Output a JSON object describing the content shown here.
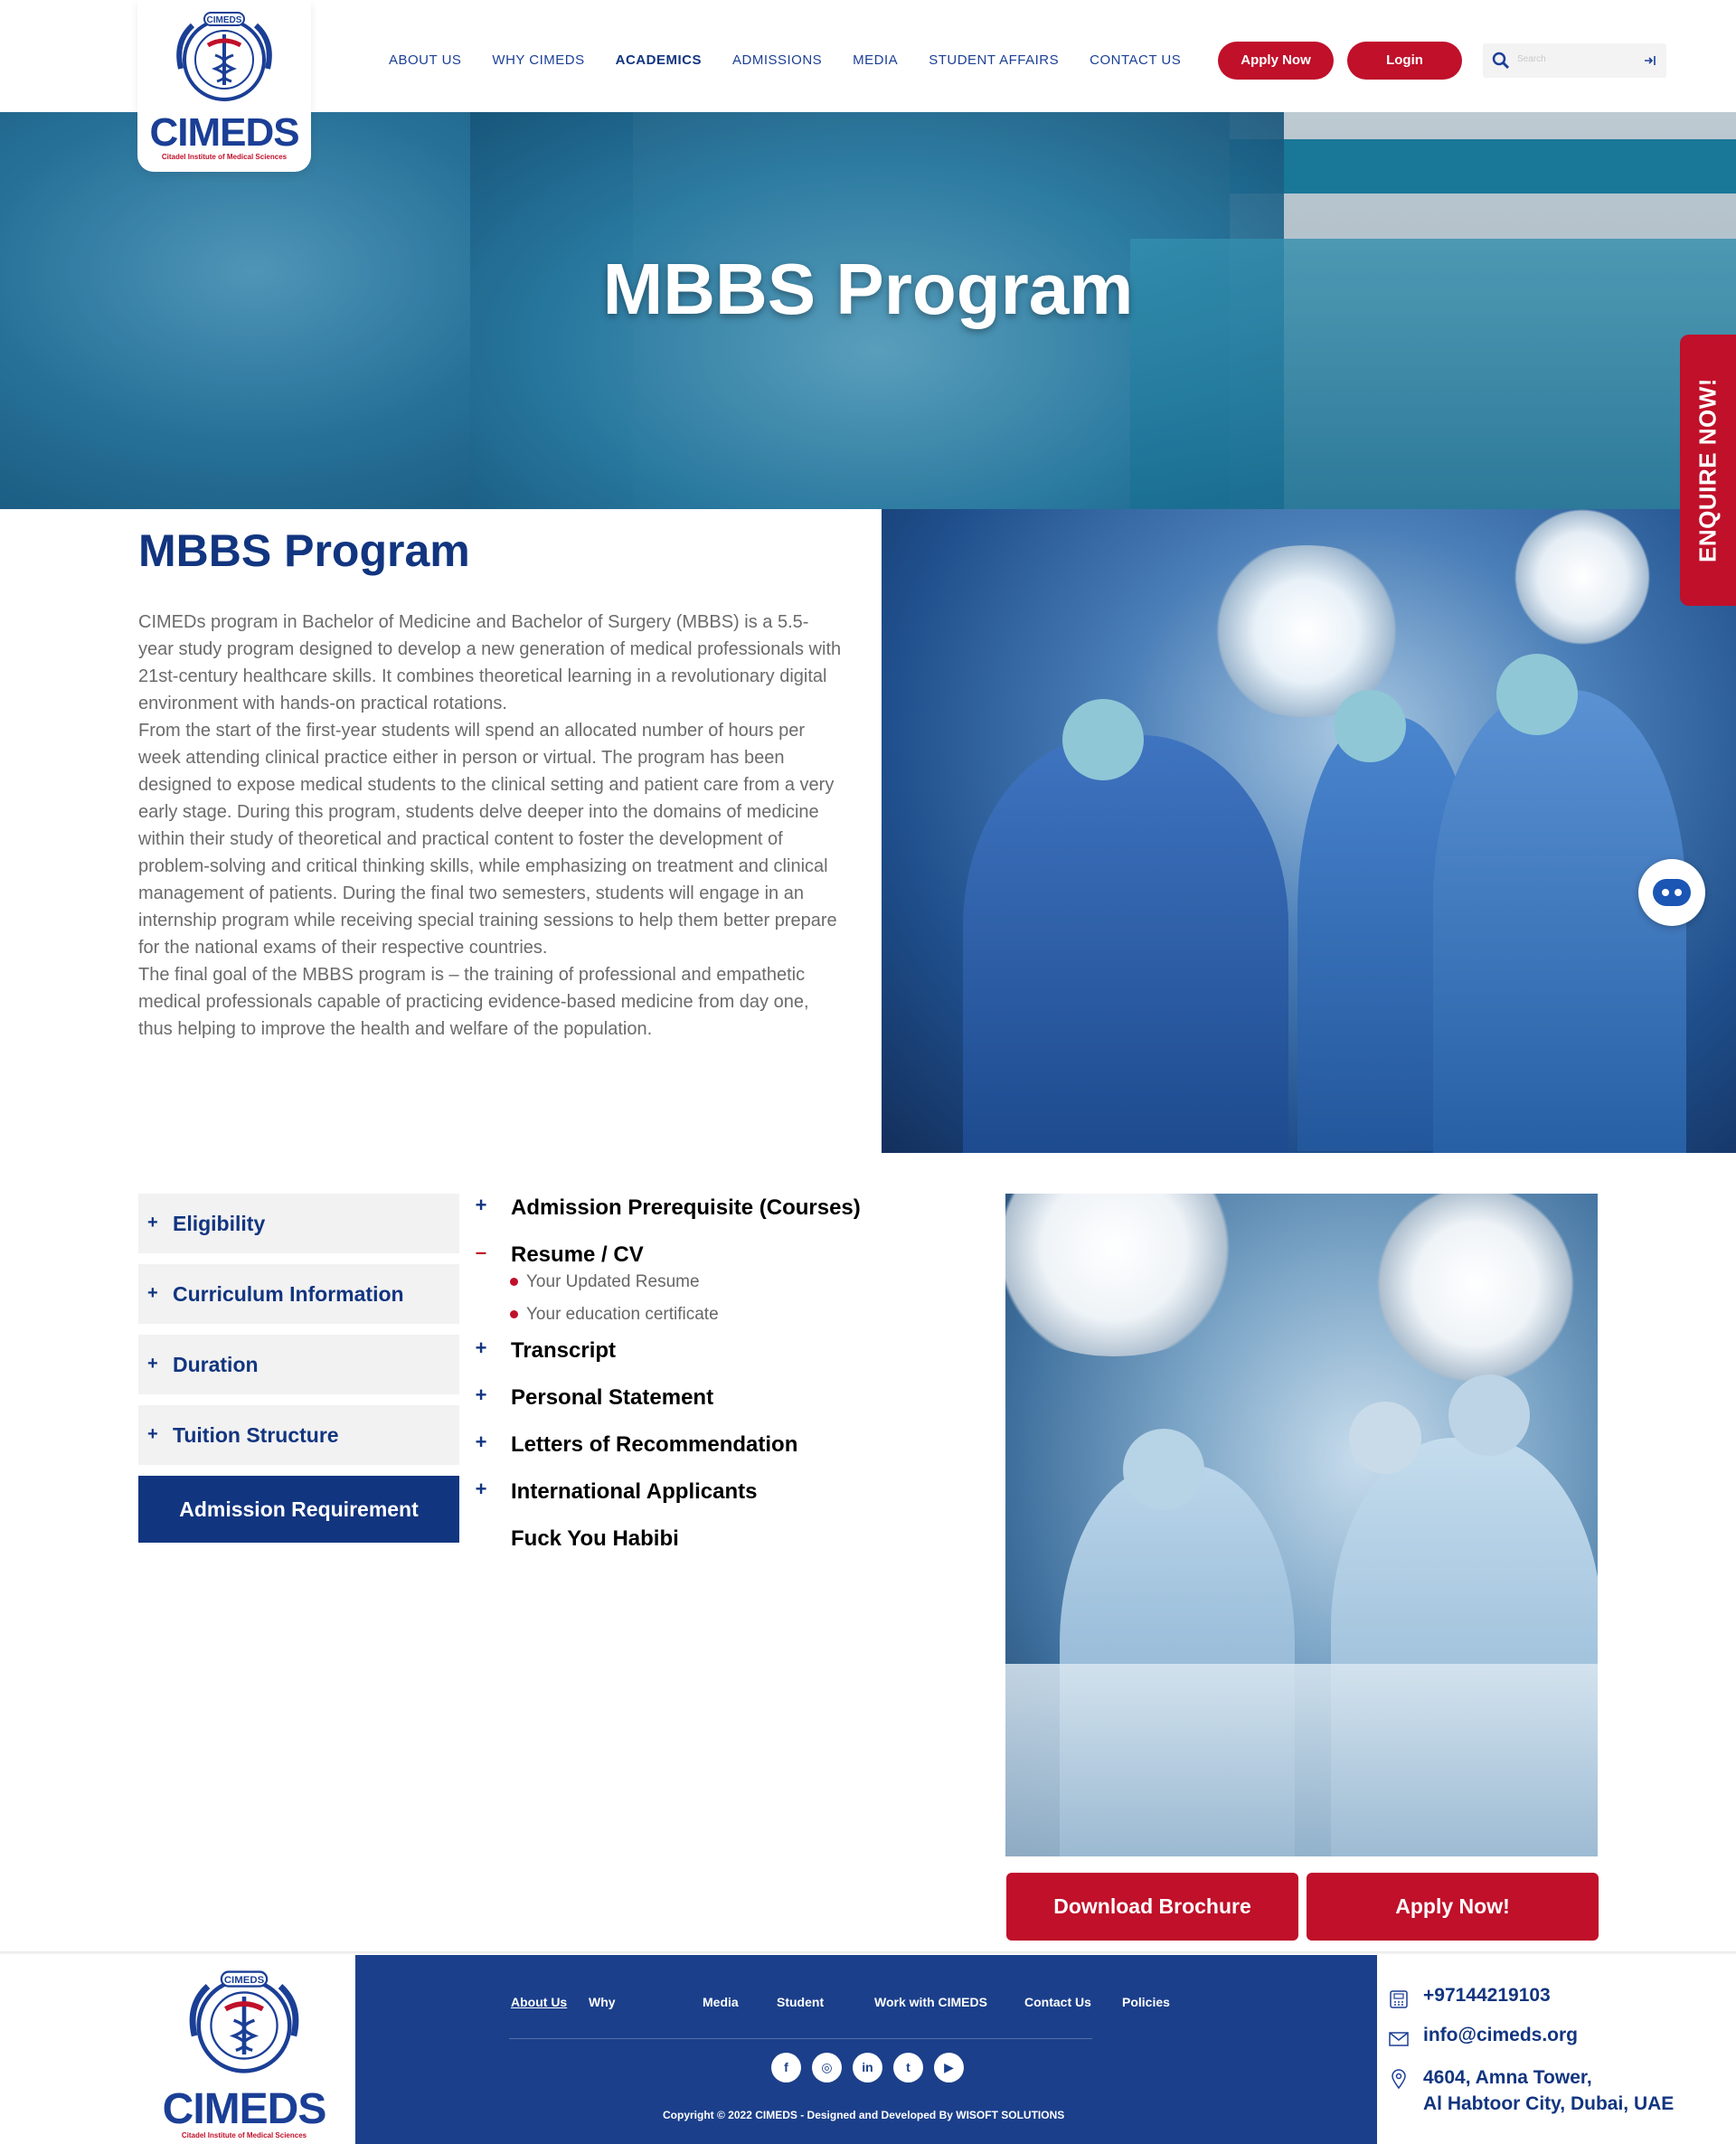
{
  "brand": {
    "name": "CIMEDS",
    "subtitle": "Citadel Institute of Medical Sciences",
    "ring_text": "CIMEDS",
    "red": "#c0102a",
    "blue": "#1b3f8a",
    "navy": "#123580"
  },
  "nav": {
    "items": [
      {
        "label": "ABOUT US"
      },
      {
        "label": "WHY CIMEDS"
      },
      {
        "label": "ACADEMICS"
      },
      {
        "label": "ADMISSIONS"
      },
      {
        "label": "MEDIA"
      },
      {
        "label": "STUDENT AFFAIRS"
      },
      {
        "label": "CONTACT US"
      }
    ],
    "active": "ACADEMICS",
    "apply_label": "Apply Now",
    "login_label": "Login",
    "search_placeholder": "Search"
  },
  "hero": {
    "title": "MBBS Program"
  },
  "enquire": {
    "label": "ENQUIRE NOW!"
  },
  "intro": {
    "title": "MBBS Program",
    "paragraphs": [
      "CIMEDs program in Bachelor of Medicine and Bachelor of Surgery (MBBS) is a 5.5-year study program designed to develop a new generation of medical professionals with 21st-century healthcare skills. It combines theoretical learning in a revolutionary digital environment with hands-on practical rotations.",
      "From the start of the first-year students will spend an allocated number of hours per week attending clinical practice either in person or virtual. The program has been designed to expose medical students to the clinical setting and patient care from a very early stage. During this program, students delve deeper into the domains of medicine within their study of theoretical and practical content to foster the development of problem-solving and critical thinking skills, while emphasizing on treatment and clinical management of patients. During the final two semesters, students will engage in an internship program while receiving special training sessions to help them better prepare for the national exams of their respective countries.",
      "The final goal of the MBBS program is – the training of professional and empathetic medical professionals capable of practicing evidence-based medicine from day one, thus helping to improve the health and welfare of the population."
    ]
  },
  "tabs": {
    "items": [
      {
        "label": "Eligibility",
        "icon": "+"
      },
      {
        "label": "Curriculum Information",
        "icon": "+"
      },
      {
        "label": "Duration",
        "icon": "+"
      },
      {
        "label": "Tuition Structure",
        "icon": "+"
      },
      {
        "label": "Admission Requirement",
        "icon": ""
      }
    ],
    "active": "Admission Requirement"
  },
  "requirements": {
    "items": [
      {
        "sign": "+",
        "title": "Admission Prerequisite (Courses)"
      },
      {
        "sign": "–",
        "title": "Resume / CV",
        "subitems": [
          "Your Updated Resume",
          "Your education certificate"
        ]
      },
      {
        "sign": "+",
        "title": "Transcript"
      },
      {
        "sign": "+",
        "title": "Personal Statement"
      },
      {
        "sign": "+",
        "title": "Letters of Recommendation"
      },
      {
        "sign": "+",
        "title": "International Applicants"
      }
    ],
    "note": "Fuck You Habibi"
  },
  "cta": {
    "download_label": "Download Brochure",
    "apply_label": "Apply Now!"
  },
  "footer": {
    "links": [
      {
        "label": "About Us",
        "underline": true
      },
      {
        "label": "Why"
      },
      {
        "label": "Media"
      },
      {
        "label": "Student"
      },
      {
        "label": "Work with CIMEDS"
      },
      {
        "label": "Contact Us"
      },
      {
        "label": "Policies"
      }
    ],
    "social": [
      {
        "icon": "facebook-icon",
        "glyph": "f"
      },
      {
        "icon": "instagram-icon",
        "glyph": "◎"
      },
      {
        "icon": "linkedin-icon",
        "glyph": "in"
      },
      {
        "icon": "twitter-icon",
        "glyph": "t"
      },
      {
        "icon": "youtube-icon",
        "glyph": "▶"
      }
    ],
    "copyright": "Copyright  © 2022 CIMEDS - Designed and Developed By WISOFT SOLUTIONS",
    "phone": "+97144219103",
    "email": "info@cimeds.org",
    "address_line1": "4604, Amna Tower,",
    "address_line2": "Al Habtoor City, Dubai, UAE"
  }
}
